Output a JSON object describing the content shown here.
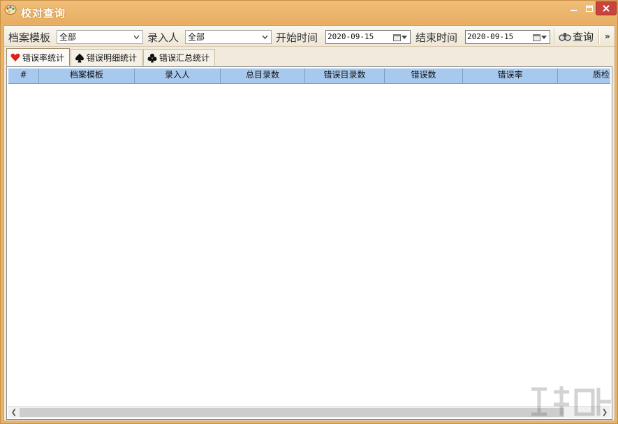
{
  "window": {
    "title": "校对查询"
  },
  "toolbar": {
    "template_label": "档案模板",
    "template_value": "全部",
    "entry_label": "录入人",
    "entry_value": "全部",
    "start_label": "开始时间",
    "start_value": "2020-09-15",
    "end_label": "结束时间",
    "end_value": "2020-09-15",
    "query_label": "查询",
    "more_label": "»"
  },
  "tabs": [
    {
      "label": "错误率统计",
      "icon": "heart-icon",
      "active": true
    },
    {
      "label": "错误明细统计",
      "icon": "spade-icon",
      "active": false
    },
    {
      "label": "错误汇总统计",
      "icon": "club-icon",
      "active": false
    }
  ],
  "grid": {
    "columns": [
      "#",
      "档案模板",
      "录入人",
      "总目录数",
      "错误目录数",
      "错误数",
      "错误率",
      "质检时"
    ],
    "rows": []
  },
  "colors": {
    "frame": "#eab36a",
    "header": "#a7c9ee",
    "close": "#c9423b",
    "client": "#f2ebdd"
  }
}
